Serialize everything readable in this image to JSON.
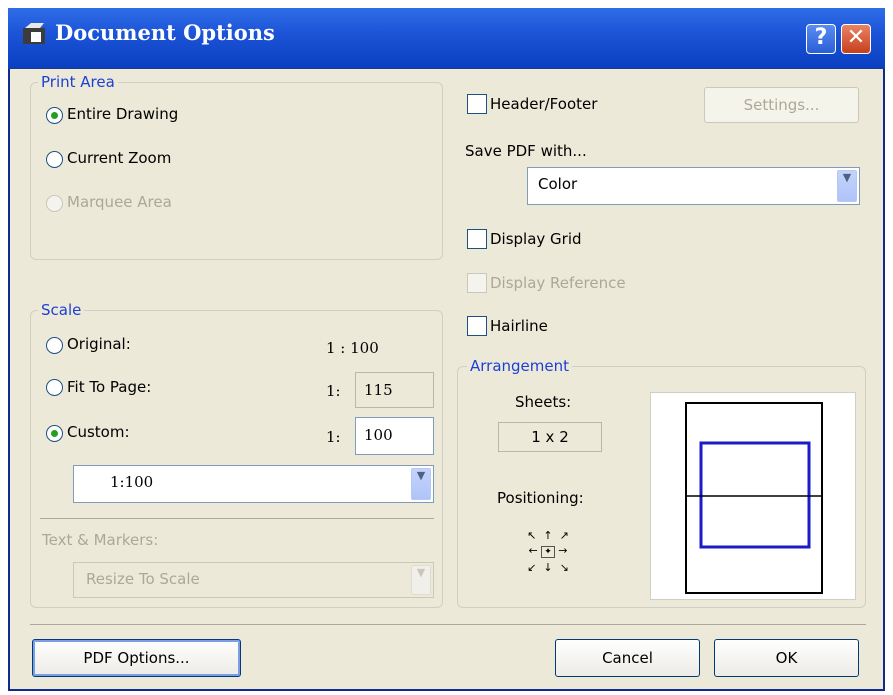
{
  "window": {
    "title": "Document Options"
  },
  "print_area": {
    "legend": "Print Area",
    "options": [
      {
        "label": "Entire Drawing",
        "selected": true,
        "enabled": true
      },
      {
        "label": "Current Zoom",
        "selected": false,
        "enabled": true
      },
      {
        "label": "Marquee Area",
        "selected": false,
        "enabled": false
      }
    ]
  },
  "scale": {
    "legend": "Scale",
    "original": {
      "label": "Original:",
      "value": "1 : 100",
      "selected": false
    },
    "fit_to_page": {
      "label": "Fit To Page:",
      "prefix": "1:",
      "value": "115",
      "selected": false
    },
    "custom": {
      "label": "Custom:",
      "prefix": "1:",
      "value": "100",
      "selected": true
    },
    "preset_select": "1:100"
  },
  "text_markers": {
    "label": "Text & Markers:",
    "select_value": "Resize To Scale",
    "enabled": false
  },
  "header_footer": {
    "label": "Header/Footer",
    "checked": false,
    "settings_label": "Settings..."
  },
  "save_pdf": {
    "label": "Save PDF with...",
    "select_value": "Color"
  },
  "display_grid": {
    "label": "Display Grid",
    "checked": false
  },
  "display_reference": {
    "label": "Display Reference",
    "checked": false,
    "enabled": false
  },
  "hairline": {
    "label": "Hairline",
    "checked": false
  },
  "arrangement": {
    "legend": "Arrangement",
    "sheets_label": "Sheets:",
    "sheets_value": "1 x 2",
    "positioning_label": "Positioning:",
    "arrows": {
      "nw": "↖",
      "n": "↑",
      "ne": "↗",
      "w": "←",
      "c": "✦",
      "e": "→",
      "sw": "↙",
      "s": "↓",
      "se": "↘"
    }
  },
  "footer": {
    "pdf_options_label": "PDF Options...",
    "cancel_label": "Cancel",
    "ok_label": "OK"
  },
  "colors": {
    "title_bar": "#0a3fc0",
    "selection_dot": "#21a121",
    "preview_frame": "#1b1bc8"
  }
}
